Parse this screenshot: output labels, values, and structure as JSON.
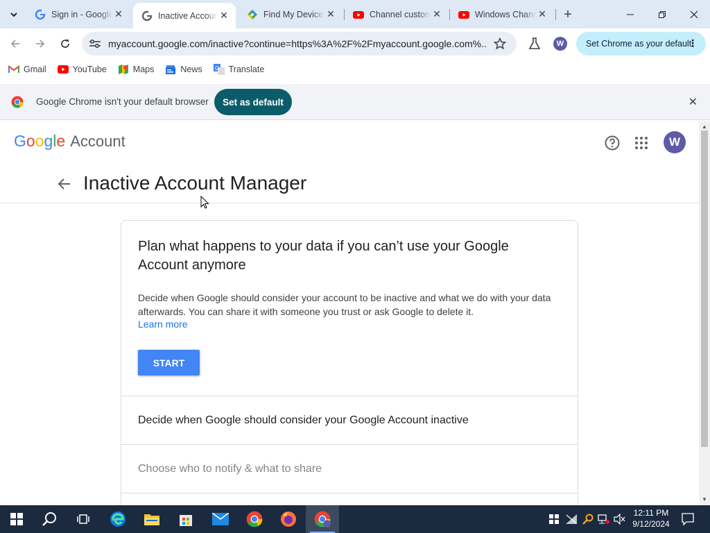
{
  "browser": {
    "tabs": [
      {
        "title": "Sign in - Google Accounts",
        "favicon": "google-g-icon",
        "active": false
      },
      {
        "title": "Inactive Account Manager",
        "favicon": "google-g-icon",
        "active": true
      },
      {
        "title": "Find My Device",
        "favicon": "find-my-device-icon",
        "active": false
      },
      {
        "title": "Channel customization",
        "favicon": "youtube-icon",
        "active": false
      },
      {
        "title": "Windows Channel",
        "favicon": "youtube-icon",
        "active": false
      }
    ],
    "url": "myaccount.google.com/inactive?continue=https%3A%2F%2Fmyaccount.google.com%...",
    "profile_initial": "W",
    "set_default_pill": "Set Chrome as your default",
    "bookmarks": [
      {
        "label": "Gmail",
        "icon": "gmail-icon"
      },
      {
        "label": "YouTube",
        "icon": "youtube-icon"
      },
      {
        "label": "Maps",
        "icon": "maps-icon"
      },
      {
        "label": "News",
        "icon": "news-icon"
      },
      {
        "label": "Translate",
        "icon": "translate-icon"
      }
    ],
    "infobar": {
      "message": "Google Chrome isn't your default browser",
      "button": "Set as default"
    }
  },
  "page": {
    "logo_google": [
      "G",
      "o",
      "o",
      "g",
      "l",
      "e"
    ],
    "logo_account": "Account",
    "avatar_initial": "W",
    "title": "Inactive Account Manager",
    "card": {
      "heading": "Plan what happens to your data if you can’t use your Google Account anymore",
      "description": "Decide when Google should consider your account to be inactive and what we do with your data afterwards. You can share it with someone you trust or ask Google to delete it.",
      "learn_more": "Learn more",
      "start_button": "START",
      "sections": [
        "Decide when Google should consider your Google Account inactive",
        "Choose who to notify & what to share"
      ]
    }
  },
  "taskbar": {
    "time": "12:11 PM",
    "date": "9/12/2024"
  },
  "colors": {
    "accent_blue": "#4285f4",
    "link_blue": "#1a73e8",
    "infobar_button": "#0b5c6b",
    "avatar": "#5e5aa8",
    "taskbar": "#1c2a3f"
  }
}
